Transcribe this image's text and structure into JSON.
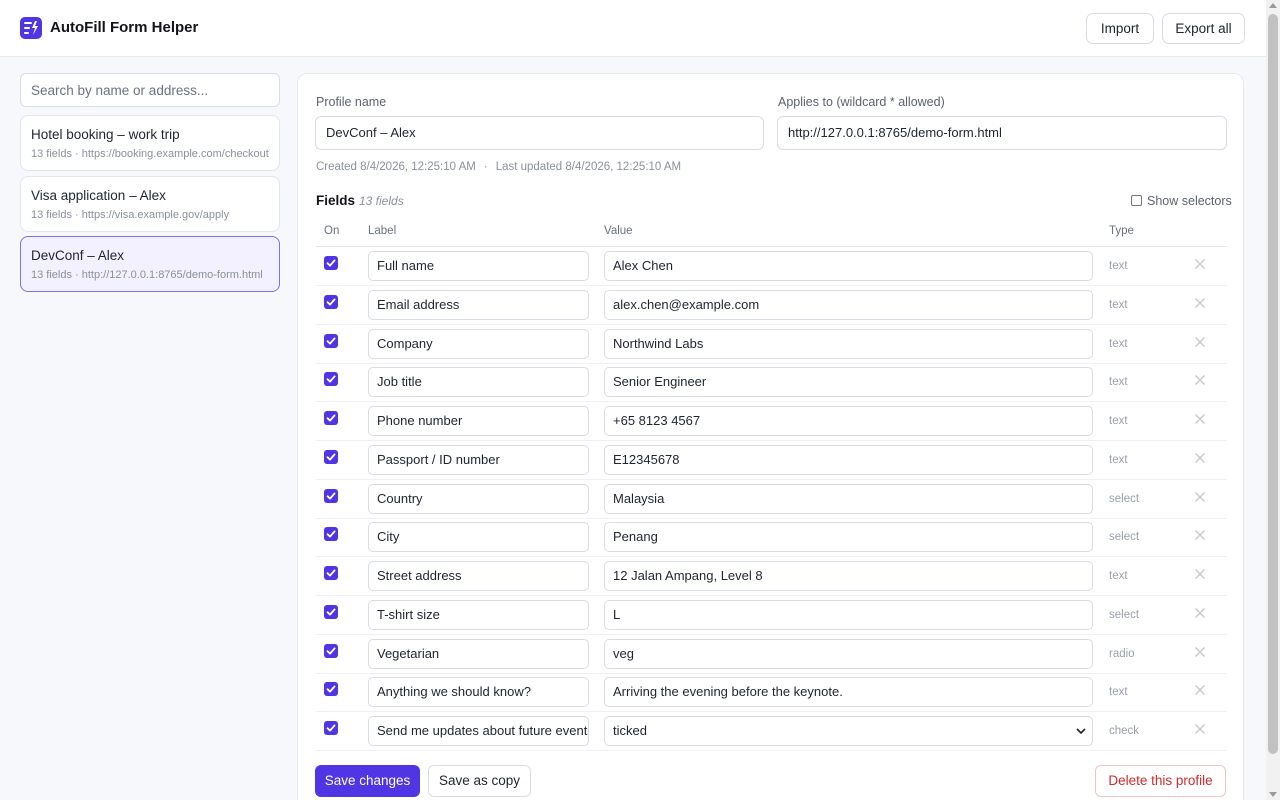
{
  "app": {
    "title": "AutoFill Form Helper",
    "icon": "form-lightning-icon"
  },
  "header": {
    "import_label": "Import",
    "export_label": "Export all"
  },
  "sidebar": {
    "search_placeholder": "Search by name or address...",
    "profiles": [
      {
        "name": "Hotel booking – work trip",
        "meta": "13 fields · https://booking.example.com/checkout"
      },
      {
        "name": "Visa application – Alex",
        "meta": "13 fields · https://visa.example.gov/apply"
      },
      {
        "name": "DevConf – Alex",
        "meta": "13 fields · http://127.0.0.1:8765/demo-form.html",
        "active": true
      }
    ]
  },
  "editor": {
    "profile_name_label": "Profile name",
    "profile_name_value": "DevConf – Alex",
    "applies_to_label": "Applies to (wildcard * allowed)",
    "applies_to_value": "http://127.0.0.1:8765/demo-form.html",
    "created": "Created 8/4/2026, 12:25:10 AM",
    "separator": "·",
    "updated": "Last updated 8/4/2026, 12:25:10 AM",
    "fields_title": "Fields",
    "fields_count": "13 fields",
    "show_selectors_label": "Show selectors",
    "show_selectors_checked": false,
    "columns": {
      "on": "On",
      "label": "Label",
      "value": "Value",
      "type": "Type"
    },
    "fields": [
      {
        "on": true,
        "label": "Full name",
        "value": "Alex Chen",
        "type": "text"
      },
      {
        "on": true,
        "label": "Email address",
        "value": "alex.chen@example.com",
        "type": "text"
      },
      {
        "on": true,
        "label": "Company",
        "value": "Northwind Labs",
        "type": "text"
      },
      {
        "on": true,
        "label": "Job title",
        "value": "Senior Engineer",
        "type": "text"
      },
      {
        "on": true,
        "label": "Phone number",
        "value": "+65 8123 4567",
        "type": "text"
      },
      {
        "on": true,
        "label": "Passport / ID number",
        "value": "E12345678",
        "type": "text"
      },
      {
        "on": true,
        "label": "Country",
        "value": "Malaysia",
        "type": "select"
      },
      {
        "on": true,
        "label": "City",
        "value": "Penang",
        "type": "select"
      },
      {
        "on": true,
        "label": "Street address",
        "value": "12 Jalan Ampang, Level 8",
        "type": "text"
      },
      {
        "on": true,
        "label": "T-shirt size",
        "value": "L",
        "type": "select"
      },
      {
        "on": true,
        "label": "Vegetarian",
        "value": "veg",
        "type": "radio"
      },
      {
        "on": true,
        "label": "Anything we should know?",
        "value": "Arriving the evening before the keynote.",
        "type": "text"
      },
      {
        "on": true,
        "label": "Send me updates about future events",
        "value": "ticked",
        "type": "check"
      }
    ],
    "save_label": "Save changes",
    "save_copy_label": "Save as copy",
    "delete_label": "Delete this profile"
  },
  "colors": {
    "accent": "#4f35e3",
    "danger": "#d12a2a",
    "active_card_bg": "#f3f0ff"
  }
}
